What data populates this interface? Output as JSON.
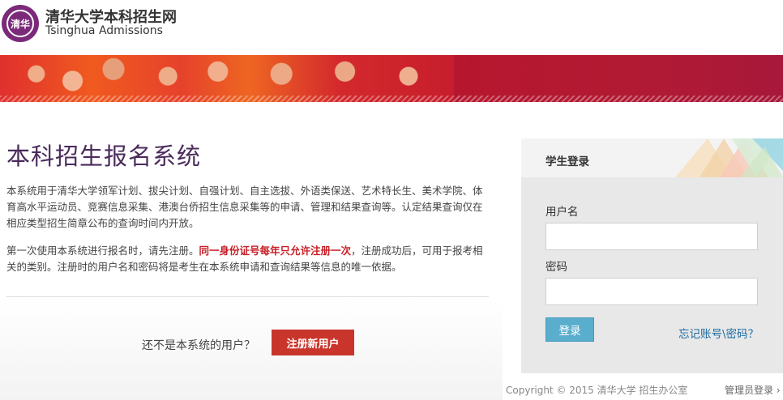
{
  "header": {
    "title_cn": "清华大学本科招生网",
    "title_en": "Tsinghua Admissions",
    "logo_icon": "tsinghua-seal-icon"
  },
  "main": {
    "page_title": "本科招生报名系统",
    "description": "本系统用于清华大学领军计划、拔尖计划、自强计划、自主选拔、外语类保送、艺术特长生、美术学院、体育高水平运动员、竞赛信息采集、港澳台侨招生信息采集等的申请、管理和结果查询等。认定结果查询仅在相应类型招生简章公布的查询时间内开放。",
    "notice_part1": "第一次使用本系统进行报名时，请先注册。",
    "notice_warning": "同一身份证号每年只允许注册一次",
    "notice_part2": "，注册成功后，可用于报考相关的类别。注册时的用户名和密码将是考生在本系统申请和查询结果等信息的唯一依据。",
    "register_prompt": "还不是本系统的用户？",
    "register_button": "注册新用户"
  },
  "login": {
    "title": "学生登录",
    "username_label": "用户名",
    "username_value": "",
    "password_label": "密码",
    "password_value": "",
    "login_button": "登录",
    "forgot_link": "忘记账号\\密码？"
  },
  "footer": {
    "copyright": "Copyright © 2015 清华大学 招生办公室",
    "admin_link": "管理员登录 ›"
  },
  "colors": {
    "accent_purple": "#4a2b5c",
    "register_red": "#c9352b",
    "warning_red": "#c81e25",
    "login_blue": "#5aaecd",
    "link_blue": "#1a6aa0"
  }
}
